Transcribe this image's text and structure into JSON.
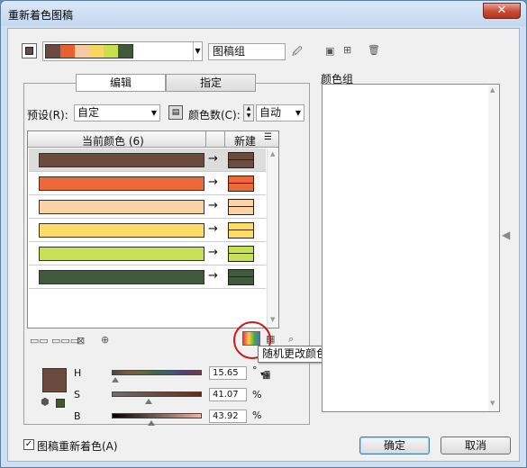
{
  "window": {
    "title": "重新着色图稿",
    "close_glyph": "✕"
  },
  "toolbar": {
    "artwork_group_label": "图稿组",
    "colors": {
      "thumb": "#6a4a40",
      "strip": [
        "#6b4b40",
        "#e86030",
        "#f8c8a0",
        "#f6d660",
        "#c8e050",
        "#3e5a3a"
      ]
    }
  },
  "tabs": [
    {
      "label": "编辑"
    },
    {
      "label": "指定"
    }
  ],
  "preset": {
    "label": "预设(R):",
    "value": "自定"
  },
  "color_count": {
    "label": "颜色数(C):",
    "value": "自动"
  },
  "table": {
    "header_current": "当前颜色 (6)",
    "header_new": "新建",
    "arrow": "→",
    "rows": [
      {
        "color": "#6b4b40",
        "selected": true
      },
      {
        "color": "#ec6a3a",
        "selected": false
      },
      {
        "color": "#fbd2a4",
        "selected": false
      },
      {
        "color": "#fddc68",
        "selected": false
      },
      {
        "color": "#c8e058",
        "selected": false
      },
      {
        "color": "#3f5a3c",
        "selected": false
      }
    ]
  },
  "tooltip": {
    "text": "随机更改颜色顺序"
  },
  "hsb": {
    "swatch_color": "#6b4b40",
    "fill_color": "#3d5a2c",
    "h": {
      "label": "H",
      "value": "15.65",
      "unit": "°",
      "level": 0.0435
    },
    "s": {
      "label": "S",
      "value": "41.07",
      "unit": "%",
      "level": 0.4107
    },
    "b": {
      "label": "B",
      "value": "43.92",
      "unit": "%",
      "level": 0.4392
    }
  },
  "color_groups": {
    "label": "颜色组"
  },
  "footer": {
    "recolor_checkbox_label": "图稿重新着色(A)",
    "recolor_checked": true,
    "ok_label": "确定",
    "cancel_label": "取消"
  }
}
